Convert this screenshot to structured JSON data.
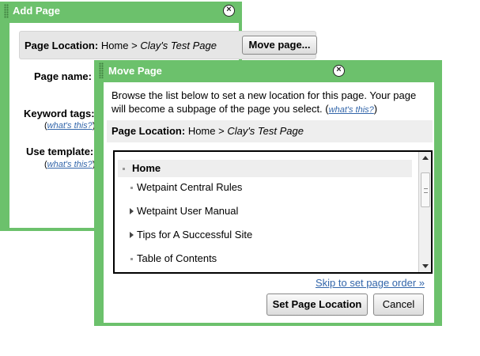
{
  "add_page": {
    "title": "Add Page",
    "location_label": "Page Location:",
    "location_path": "Home > ",
    "location_page": "Clay's Test Page",
    "move_button": "Move page...",
    "page_name_label": "Page name:",
    "keyword_tags_label": "Keyword tags:",
    "use_template_label": "Use template:",
    "help_open": "(",
    "help_link": "what's this?",
    "help_close": ")"
  },
  "move_page": {
    "title": "Move Page",
    "instructions": "Browse the list below to set a new location for this page. Your page will become a subpage of the page you select.",
    "help_open": "(",
    "help_link": "what's this?",
    "help_close": ")",
    "location_label": "Page Location:",
    "location_path": "Home > ",
    "location_page": "Clay's Test Page",
    "tree": {
      "root": "Home",
      "children": [
        {
          "label": "Wetpaint Central Rules",
          "icon": "bullet-icon"
        },
        {
          "label": "Wetpaint User Manual",
          "icon": "expand-arrow-icon"
        },
        {
          "label": "Tips for A Successful Site",
          "icon": "expand-arrow-icon"
        },
        {
          "label": "Table of Contents",
          "icon": "bullet-icon"
        }
      ]
    },
    "skip_link": "Skip to set page order »",
    "set_button": "Set Page Location",
    "cancel_button": "Cancel"
  },
  "colors": {
    "dialog_frame": "#6cc16c",
    "link": "#3366aa",
    "strip": "#e6e6e6"
  }
}
